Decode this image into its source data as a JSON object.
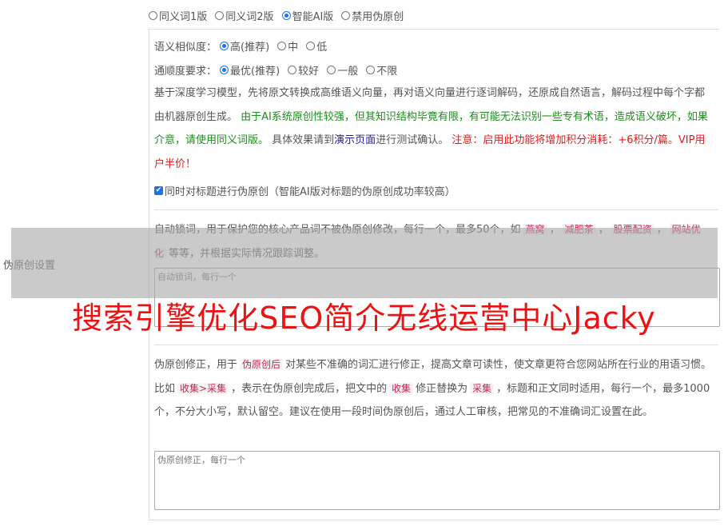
{
  "side_label": "伪原创设置",
  "mode_options": [
    {
      "label": "同义词1版",
      "checked": false
    },
    {
      "label": "同义词2版",
      "checked": false
    },
    {
      "label": "智能AI版",
      "checked": true
    },
    {
      "label": "禁用伪原创",
      "checked": false
    }
  ],
  "similarity": {
    "label": "语义相似度：",
    "options": [
      {
        "label": "高(推荐)",
        "checked": true
      },
      {
        "label": "中",
        "checked": false
      },
      {
        "label": "低",
        "checked": false
      }
    ]
  },
  "fluency": {
    "label": "通顺度要求：",
    "options": [
      {
        "label": "最优(推荐)",
        "checked": true
      },
      {
        "label": "较好",
        "checked": false
      },
      {
        "label": "一般",
        "checked": false
      },
      {
        "label": "不限",
        "checked": false
      }
    ]
  },
  "desc": {
    "part1": "基于深度学习模型，先将原文转换成高维语义向量，再对语义向量进行逐词解码，还原成自然语言，解码过程中每个字都由机器原创生成。",
    "green": "由于AI系统原创性较强，但其知识结构毕竟有限，有可能无法识别一些专有术语，造成语义破坏，如果介意，请使用同义词版。",
    "part2": "具体效果请到",
    "link": "演示页面",
    "part3": "进行测试确认。",
    "red": "注意：启用此功能将增加积分消耗：+6积分/篇。VIP用户半价！"
  },
  "title_check": {
    "label": "同时对标题进行伪原创（智能AI版对标题的伪原创成功率较高）",
    "checked": true
  },
  "lock_words": {
    "text_before": "自动锁词，用于保护您的核心产品词不被伪原创修改，每行一个，最多50个，如",
    "tags": [
      "燕窝",
      "减肥茶",
      "股票配资",
      "网站优化"
    ],
    "sep": "，",
    "text_after": "等等，并根据实际情况跟踪调整。",
    "placeholder": "自动锁词，每行一个"
  },
  "correction": {
    "t1": "伪原创修正，用于",
    "tag1": "伪原创后",
    "t2": "对某些不准确的词汇进行修正，提高文章可读性，使文章更符合您网站所在行业的用语习惯。比如",
    "tag2": "收集>采集",
    "t3": "，表示在伪原创完成后，把文中的",
    "tag3": "收集",
    "t4": "修正替换为",
    "tag4": "采集",
    "t5": "，标题和正文同时适用，每行一个，最多1000个，不分大小写，默认留空。建议在使用一段时间伪原创后，通过人工审核，把常见的不准确词汇设置在此。",
    "placeholder": "伪原创修正，每行一个"
  },
  "watermark": "搜索引擎优化SEO简介无线运营中心Jacky",
  "colors": {
    "accent": "#1a73e8",
    "green": "#1e8b1e",
    "red": "#e01b1b",
    "link": "#1a1aa6",
    "tag_text": "#c7254e"
  }
}
